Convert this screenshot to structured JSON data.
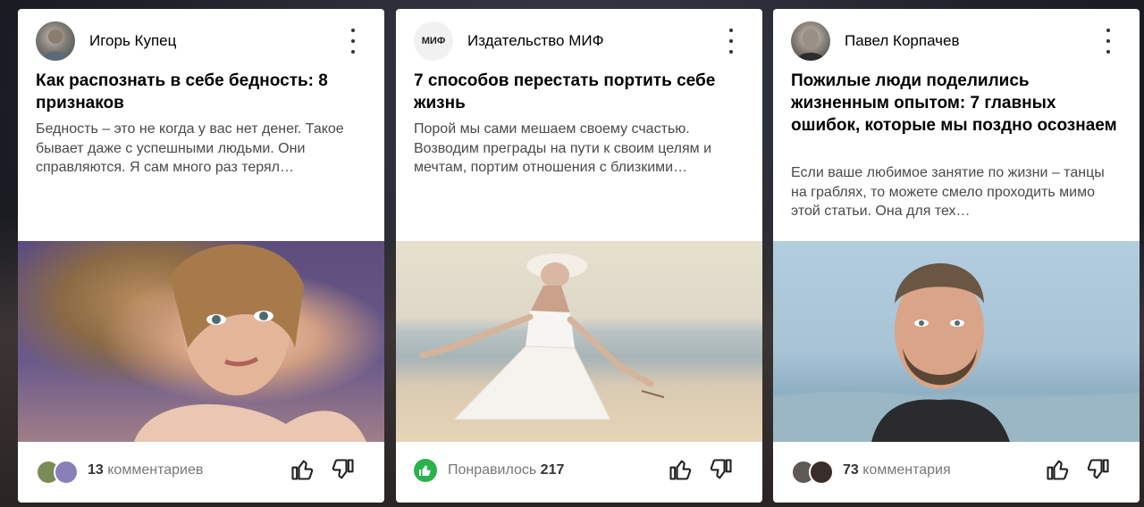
{
  "cards": [
    {
      "author": "Игорь Купец",
      "title": "Как распознать в себе бедность: 8 признаков",
      "snippet": "Бедность – это не когда у вас нет денег. Такое бывает даже с успешными людьми. Они справляются. Я сам много раз терял…",
      "footer": {
        "count": "13",
        "text": "комментариев"
      },
      "avatar_icon": "person-avatar-icon",
      "image_desc": "woman-portrait-image"
    },
    {
      "author": "Издательство МИФ",
      "title": "7 способов перестать портить себе жизнь",
      "snippet": "Порой мы сами мешаем своему счастью. Возводим преграды на пути к своим целям и мечтам, портим отношения с близкими…",
      "footer": {
        "text": "Понравилось",
        "count": "217"
      },
      "avatar_text": "МИФ",
      "image_desc": "woman-on-beach-image"
    },
    {
      "author": "Павел Корпачев",
      "title": "Пожилые люди поделились жизненным опытом: 7 главных ошибок, которые мы поздно осознаем",
      "snippet": "Если ваше любимое занятие по жизни – танцы на граблях, то можете смело проходить мимо этой статьи. Она для тех…",
      "footer": {
        "count": "73",
        "text": "комментария"
      },
      "avatar_icon": "person-avatar-icon",
      "image_desc": "man-portrait-image"
    }
  ],
  "colors": {
    "like_green": "#2ab24c",
    "text_gray": "#4a4a4a",
    "card_bg": "#ffffff"
  }
}
